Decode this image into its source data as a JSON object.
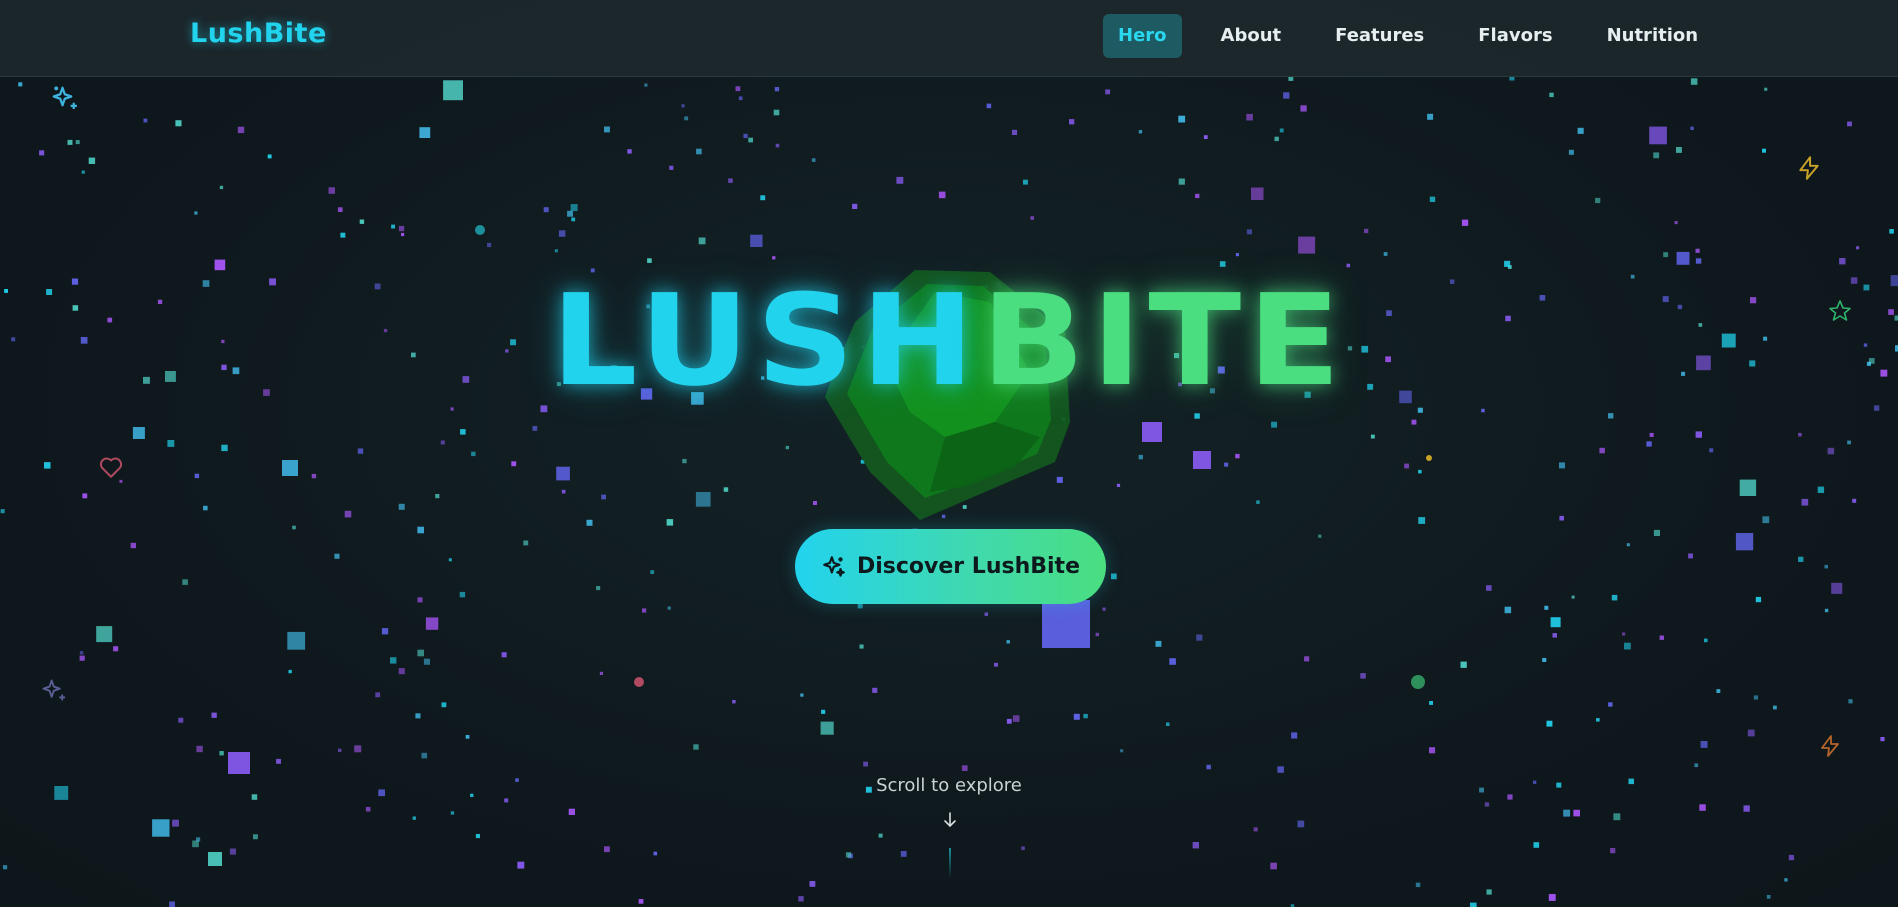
{
  "nav": {
    "brand": "LushBite",
    "links": [
      {
        "label": "Hero",
        "active": true
      },
      {
        "label": "About",
        "active": false
      },
      {
        "label": "Features",
        "active": false
      },
      {
        "label": "Flavors",
        "active": false
      },
      {
        "label": "Nutrition",
        "active": false
      }
    ]
  },
  "hero": {
    "title_part1": "LUSH",
    "title_part2": "BITE",
    "cta_label": "Discover LushBite",
    "cta_icon": "sparkles-icon",
    "scroll_hint": "Scroll to explore",
    "scroll_icon": "arrow-down-icon"
  },
  "decor_icons": [
    "sparkles-icon",
    "zap-icon",
    "star-icon",
    "heart-icon",
    "sparkles-icon",
    "zap-icon"
  ],
  "colors": {
    "background": "#101a1e",
    "cyan": "#22d3ee",
    "green": "#4ade80",
    "purple": "#8b5cf6",
    "indigo": "#6366f1",
    "active_nav_bg": "#1e5a61"
  }
}
